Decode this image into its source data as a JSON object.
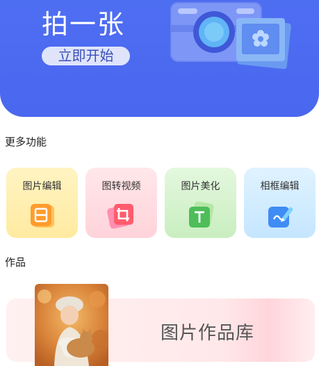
{
  "hero": {
    "title": "拍一张",
    "start_button": "立即开始",
    "background_color": "#4e6ef2"
  },
  "more_features": {
    "title": "更多功能",
    "items": [
      {
        "label": "图片编辑",
        "icon": "edit-document-icon",
        "bg": "#fff4c2"
      },
      {
        "label": "图转视频",
        "icon": "crop-video-icon",
        "bg": "#ffe1e6"
      },
      {
        "label": "图片美化",
        "icon": "text-beautify-icon",
        "bg": "#dcf5d6"
      },
      {
        "label": "相框编辑",
        "icon": "pen-frame-icon",
        "bg": "#d7efff"
      }
    ]
  },
  "works": {
    "title": "作品",
    "gallery_label": "图片作品库",
    "thumbnail": "child-with-cat-photo"
  }
}
